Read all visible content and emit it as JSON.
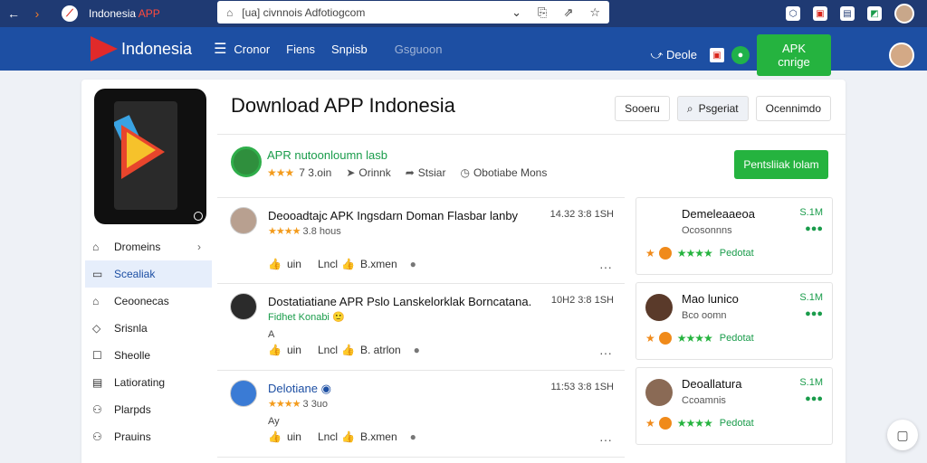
{
  "browser": {
    "tab_title_main": "Indonesia",
    "tab_title_accent": "APP",
    "url": "[ua] civnnois Adfotiogcom"
  },
  "header": {
    "logo_text": "Indonesia",
    "nav": [
      "Cronor",
      "Fiens",
      "Snpisb",
      "Gsguoon"
    ],
    "download_label": "Deole",
    "apk_button": "APK cnrige"
  },
  "sidebar": {
    "items": [
      {
        "icon": "home-icon",
        "label": "Dromeins"
      },
      {
        "icon": "folder-icon",
        "label": "Scealiak"
      },
      {
        "icon": "home-icon",
        "label": "Ceoonecas"
      },
      {
        "icon": "tag-icon",
        "label": "Srisnla"
      },
      {
        "icon": "box-icon",
        "label": "Sheolle"
      },
      {
        "icon": "list-icon",
        "label": "Latiorating"
      },
      {
        "icon": "group-icon",
        "label": "Plarpds"
      },
      {
        "icon": "group-icon",
        "label": "Prauins"
      }
    ]
  },
  "main": {
    "title": "Download APP Indonesia",
    "tabs": [
      "Sooeru",
      "Psgeriat",
      "Ocennimdo"
    ]
  },
  "app": {
    "name": "APR nutoonloumn lasb",
    "rating_count": "7 3.oin",
    "meta_1": "Orinnk",
    "meta_2": "Stsiar",
    "meta_3": "Obotiabe Mons",
    "install_button": "Pentsliiak lolam"
  },
  "reviews": [
    {
      "title": "Deooadtajc APK Ingsdarn Doman Flasbar lanby",
      "stars_count": "3.8 hous",
      "date": "14.32 3:8 1SH",
      "like": "uin",
      "share": "Lncl",
      "reply": "B.xmen",
      "note": ""
    },
    {
      "title": "Dostatiatiane APR Pslo Lanskelorklak Borncatana.",
      "sub_green": "Fidhet Konabi",
      "date": "10H2 3:8 1SH",
      "like": "uin",
      "share": "Lncl",
      "reply": "B. atrlon",
      "note": "A"
    },
    {
      "title": "Delotiane",
      "stars_count": "3 3uo",
      "date": "11:53 3:8 1SH",
      "like": "uin",
      "share": "Lncl",
      "reply": "B.xmen",
      "note": "Ay"
    }
  ],
  "cards": [
    {
      "name": "Demeleaaeoa",
      "sub": "Ocosonnns",
      "value": "S.1M",
      "label": "Pedotat"
    },
    {
      "name": "Mao lunico",
      "sub": "Bco oomn",
      "value": "S.1M",
      "label": "Pedotat"
    },
    {
      "name": "Deoallatura",
      "sub": "Ccoamnis",
      "value": "S.1M",
      "label": "Pedotat"
    }
  ]
}
